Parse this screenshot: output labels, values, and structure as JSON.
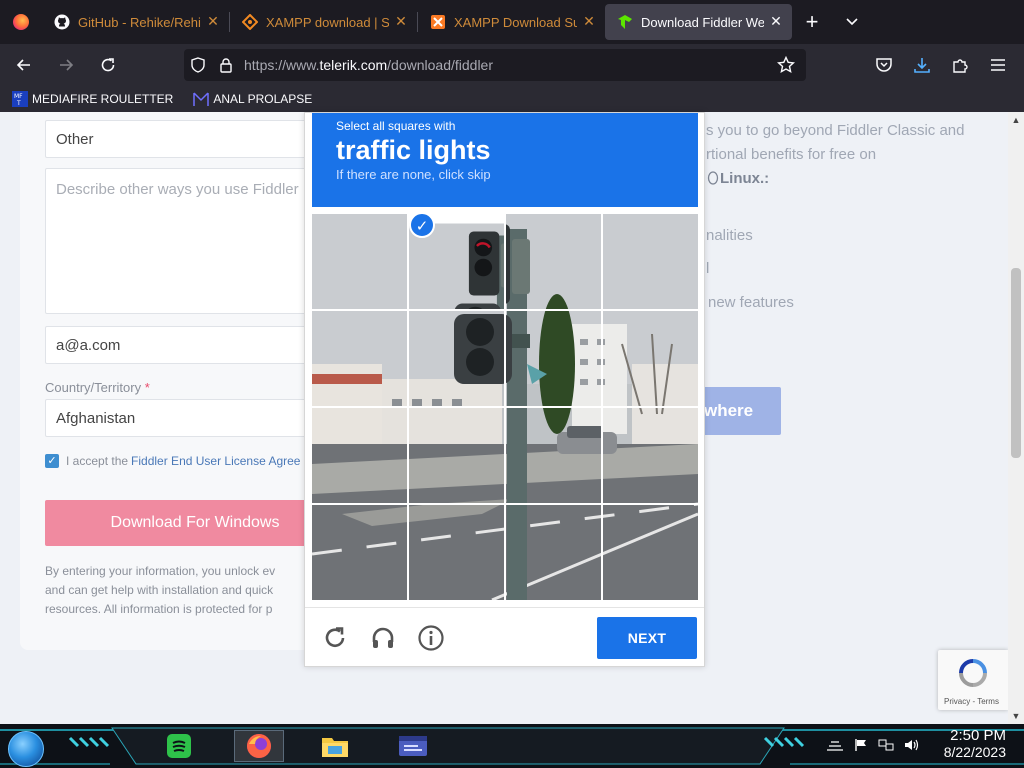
{
  "browser": {
    "tabs": [
      {
        "title": "GitHub - Rehike/Rehike",
        "icon": "github-icon",
        "active": false
      },
      {
        "title": "XAMPP download | Sou",
        "icon": "sourceforge-icon",
        "active": false
      },
      {
        "title": "XAMPP Download Succ",
        "icon": "xampp-icon",
        "active": false
      },
      {
        "title": "Download Fiddler Web D",
        "icon": "telerik-icon",
        "active": true
      }
    ],
    "close_glyph": "✕",
    "newtab_glyph": "+",
    "url": {
      "prefix": "https://www.",
      "host": "telerik.com",
      "path": "/download/fiddler"
    },
    "bookmarks": [
      {
        "label": "MEDIAFIRE ROULETTER",
        "icon": "mediafire-icon"
      },
      {
        "label": "ANAL PROLAPSE",
        "icon": "bookmark-site-icon"
      }
    ]
  },
  "form": {
    "use_select_value": "Other",
    "describe_placeholder": "Describe other ways you use Fiddler",
    "email_value": "a@a.com",
    "country_label": "Country/Territory",
    "required_mark": "*",
    "country_value": "Afghanistan",
    "accept_text": "I accept the",
    "accept_link": "Fiddler End User License Agree",
    "download_button": "Download For Windows",
    "fineprint": [
      "By entering your information, you unlock ev",
      "and can get help with installation and quick",
      "resources. All information is protected for p"
    ]
  },
  "right_column": {
    "line1": "s you to go beyond Fiddler Classic and",
    "line2": "rtional benefits for free on",
    "line3_bold": "Linux",
    "line3_suffix": ".:",
    "item1": "nalities",
    "item2": "l",
    "item3": "new features",
    "buy_button": "where"
  },
  "captcha": {
    "instruction_small": "Select all squares with",
    "target": "traffic lights",
    "hint": "If there are none, click skip",
    "selected_tiles": [
      1
    ],
    "reload_icon": "reload-icon",
    "audio_icon": "headphones-icon",
    "info_icon": "info-icon",
    "next_button": "NEXT"
  },
  "recaptcha_badge": {
    "footer": "Privacy - Terms"
  },
  "taskbar": {
    "apps": [
      {
        "name": "spotify-icon",
        "active": false
      },
      {
        "name": "firefox-icon",
        "active": true
      },
      {
        "name": "file-explorer-icon",
        "active": false
      },
      {
        "name": "window-app-icon",
        "active": false
      }
    ],
    "time": "2:50 PM",
    "date": "8/22/2023"
  },
  "colors": {
    "captcha_blue": "#1a73e8",
    "download_pink": "#f08aa0",
    "browser_dark": "#1c1b22"
  }
}
